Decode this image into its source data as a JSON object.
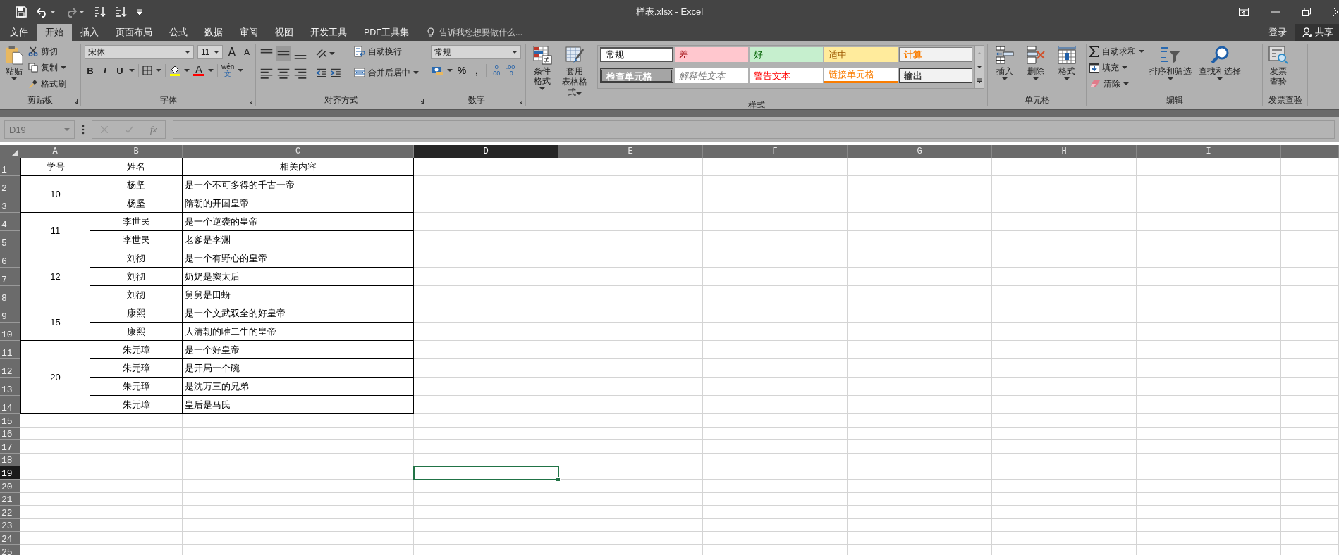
{
  "window": {
    "title": "样表.xlsx - Excel"
  },
  "quick_access": [
    {
      "kind": "save",
      "disabled": false
    },
    {
      "kind": "undo",
      "disabled": false
    },
    {
      "kind": "redo",
      "disabled": true
    },
    {
      "kind": "sort_asc",
      "disabled": false
    },
    {
      "kind": "sort_desc",
      "disabled": false
    },
    {
      "kind": "customize",
      "disabled": false
    }
  ],
  "window_controls": [
    {
      "kind": "ribbon_options"
    },
    {
      "kind": "minimize"
    },
    {
      "kind": "restore"
    },
    {
      "kind": "close"
    }
  ],
  "tabs": [
    {
      "label": "文件",
      "selected": false
    },
    {
      "label": "开始",
      "selected": true
    },
    {
      "label": "插入",
      "selected": false
    },
    {
      "label": "页面布局",
      "selected": false
    },
    {
      "label": "公式",
      "selected": false
    },
    {
      "label": "数据",
      "selected": false
    },
    {
      "label": "审阅",
      "selected": false
    },
    {
      "label": "视图",
      "selected": false
    },
    {
      "label": "开发工具",
      "selected": false
    },
    {
      "label": "PDF工具集",
      "selected": false
    }
  ],
  "tell_me": {
    "placeholder": "告诉我您想要做什么..."
  },
  "account": {
    "sign_in": "登录",
    "share": "共享"
  },
  "ribbon": {
    "clipboard": {
      "label": "剪贴板",
      "paste": "粘贴",
      "cut": "剪切",
      "copy": "复制",
      "format_painter": "格式刷"
    },
    "font": {
      "label": "字体",
      "font_name": "宋体",
      "font_size": "11",
      "grow": "A",
      "shrink": "A",
      "bold": "B",
      "italic": "I",
      "underline": "U",
      "font_color_glyph": "A",
      "phonetic": [
        "wén",
        "文"
      ]
    },
    "alignment": {
      "label": "对齐方式",
      "vertical": [
        {
          "selected": false
        },
        {
          "selected": true
        },
        {
          "selected": false
        }
      ],
      "wrap_text": "自动换行",
      "merge_center": "合并后居中"
    },
    "number": {
      "label": "数字",
      "format": "常规",
      "percent": "%",
      "comma": ",",
      "increase_decimal": [
        ".0",
        ".00"
      ],
      "decrease_decimal": [
        ".00",
        ".0"
      ]
    },
    "styles": {
      "label": "样式",
      "conditional_formatting": "条件格式",
      "format_as_table": [
        "套用",
        "表格格式"
      ],
      "gallery": [
        {
          "label": "常规",
          "kind": "normal"
        },
        {
          "label": "差",
          "kind": "bad"
        },
        {
          "label": "好",
          "kind": "good"
        },
        {
          "label": "适中",
          "kind": "neutral"
        },
        {
          "label": "计算",
          "kind": "calculation"
        },
        {
          "label": "检查单元格",
          "kind": "check"
        },
        {
          "label": "解释性文本",
          "kind": "explanatory"
        },
        {
          "label": "警告文本",
          "kind": "warning"
        },
        {
          "label": "链接单元格",
          "kind": "linked"
        },
        {
          "label": "输出",
          "kind": "output"
        }
      ]
    },
    "cells": {
      "label": "单元格",
      "buttons": [
        {
          "label": "插入",
          "kind": "insert"
        },
        {
          "label": "删除",
          "kind": "delete"
        },
        {
          "label": "格式",
          "kind": "format"
        }
      ]
    },
    "editing": {
      "label": "编辑",
      "autosum": "自动求和",
      "fill": "填充",
      "clear": "清除",
      "sort_filter": "排序和筛选",
      "find_select": "查找和选择"
    },
    "invoice": {
      "label": "发票查验",
      "button": [
        "发票",
        "查验"
      ]
    }
  },
  "sheet": {
    "name_box": "D19",
    "fx": "fx",
    "columns": [
      {
        "letter": "A",
        "selected": false
      },
      {
        "letter": "B",
        "selected": false
      },
      {
        "letter": "C",
        "selected": false
      },
      {
        "letter": "D",
        "selected": true
      },
      {
        "letter": "E",
        "selected": false
      },
      {
        "letter": "F",
        "selected": false
      },
      {
        "letter": "G",
        "selected": false
      },
      {
        "letter": "H",
        "selected": false
      },
      {
        "letter": "I",
        "selected": false
      }
    ],
    "row_numbers": [
      {
        "label": "1",
        "selected": false
      },
      {
        "label": "2",
        "selected": false
      },
      {
        "label": "3",
        "selected": false
      },
      {
        "label": "4",
        "selected": false
      },
      {
        "label": "5",
        "selected": false
      },
      {
        "label": "6",
        "selected": false
      },
      {
        "label": "7",
        "selected": false
      },
      {
        "label": "8",
        "selected": false
      },
      {
        "label": "9",
        "selected": false
      },
      {
        "label": "10",
        "selected": false
      },
      {
        "label": "11",
        "selected": false
      },
      {
        "label": "12",
        "selected": false
      },
      {
        "label": "13",
        "selected": false
      },
      {
        "label": "14",
        "selected": false
      },
      {
        "label": "15",
        "selected": false
      },
      {
        "label": "16",
        "selected": false
      },
      {
        "label": "17",
        "selected": false
      },
      {
        "label": "18",
        "selected": false
      },
      {
        "label": "19",
        "selected": true
      },
      {
        "label": "20",
        "selected": false
      },
      {
        "label": "21",
        "selected": false
      },
      {
        "label": "22",
        "selected": false
      },
      {
        "label": "23",
        "selected": false
      },
      {
        "label": "24",
        "selected": false
      },
      {
        "label": "25",
        "selected": false
      }
    ],
    "header": [
      "学号",
      "姓名",
      "相关内容"
    ],
    "groups": [
      {
        "id": "10",
        "rows": [
          {
            "name": "杨坚",
            "content": "是一个不可多得的千古一帝"
          },
          {
            "name": "杨坚",
            "content": "隋朝的开国皇帝"
          }
        ]
      },
      {
        "id": "11",
        "rows": [
          {
            "name": "李世民",
            "content": "是一个逆袭的皇帝"
          },
          {
            "name": "李世民",
            "content": "老爹是李渊"
          }
        ]
      },
      {
        "id": "12",
        "rows": [
          {
            "name": "刘彻",
            "content": "是一个有野心的皇帝"
          },
          {
            "name": "刘彻",
            "content": "奶奶是窦太后"
          },
          {
            "name": "刘彻",
            "content": "舅舅是田蚡"
          }
        ]
      },
      {
        "id": "15",
        "rows": [
          {
            "name": "康熙",
            "content": "是一个文武双全的好皇帝"
          },
          {
            "name": "康熙",
            "content": "大清朝的唯二牛的皇帝"
          }
        ]
      },
      {
        "id": "20",
        "rows": [
          {
            "name": "朱元璋",
            "content": "是一个好皇帝"
          },
          {
            "name": "朱元璋",
            "content": "是开局一个碗"
          },
          {
            "name": "朱元璋",
            "content": "是沈万三的兄弟"
          },
          {
            "name": "朱元璋",
            "content": "皇后是马氏"
          }
        ]
      }
    ]
  }
}
